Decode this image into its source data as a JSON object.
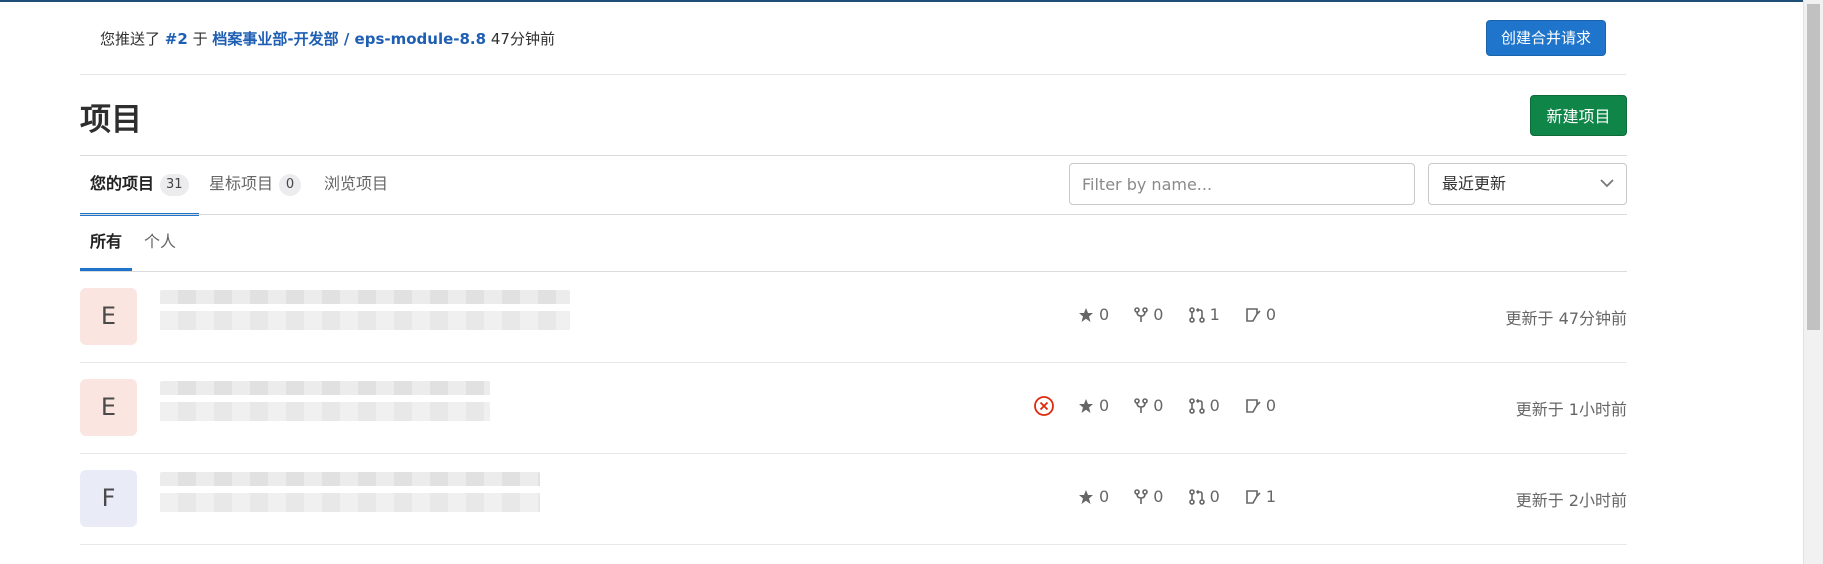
{
  "push_notice": {
    "prefix": "您推送了",
    "ref": "#2",
    "middle": "于",
    "project": "档案事业部-开发部 / eps-module-8.8",
    "time": "47分钟前",
    "button": "创建合并请求"
  },
  "page": {
    "title": "项目",
    "new_button": "新建项目"
  },
  "tabs": [
    {
      "label": "您的项目",
      "count": "31",
      "active": true
    },
    {
      "label": "星标项目",
      "count": "0",
      "active": false
    },
    {
      "label": "浏览项目",
      "count": null,
      "active": false
    }
  ],
  "filter": {
    "placeholder": "Filter by name...",
    "sort_label": "最近更新"
  },
  "subtabs": [
    {
      "label": "所有",
      "active": true
    },
    {
      "label": "个人",
      "active": false
    }
  ],
  "projects": [
    {
      "avatar_letter": "E",
      "avatar_color": "#fbe5e1",
      "stars": "0",
      "forks": "0",
      "merge_requests": "1",
      "issues": "0",
      "updated": "更新于 47分钟前",
      "pipeline_failed": false
    },
    {
      "avatar_letter": "E",
      "avatar_color": "#fbe5e1",
      "stars": "0",
      "forks": "0",
      "merge_requests": "0",
      "issues": "0",
      "updated": "更新于 1小时前",
      "pipeline_failed": true
    },
    {
      "avatar_letter": "F",
      "avatar_color": "#e9ebf7",
      "stars": "0",
      "forks": "0",
      "merge_requests": "0",
      "issues": "1",
      "updated": "更新于 2小时前",
      "pipeline_failed": false
    }
  ],
  "colors": {
    "link": "#1f5fb3",
    "primary_button": "#1f75cb",
    "success_button": "#108548",
    "error": "#dd2b0e"
  }
}
